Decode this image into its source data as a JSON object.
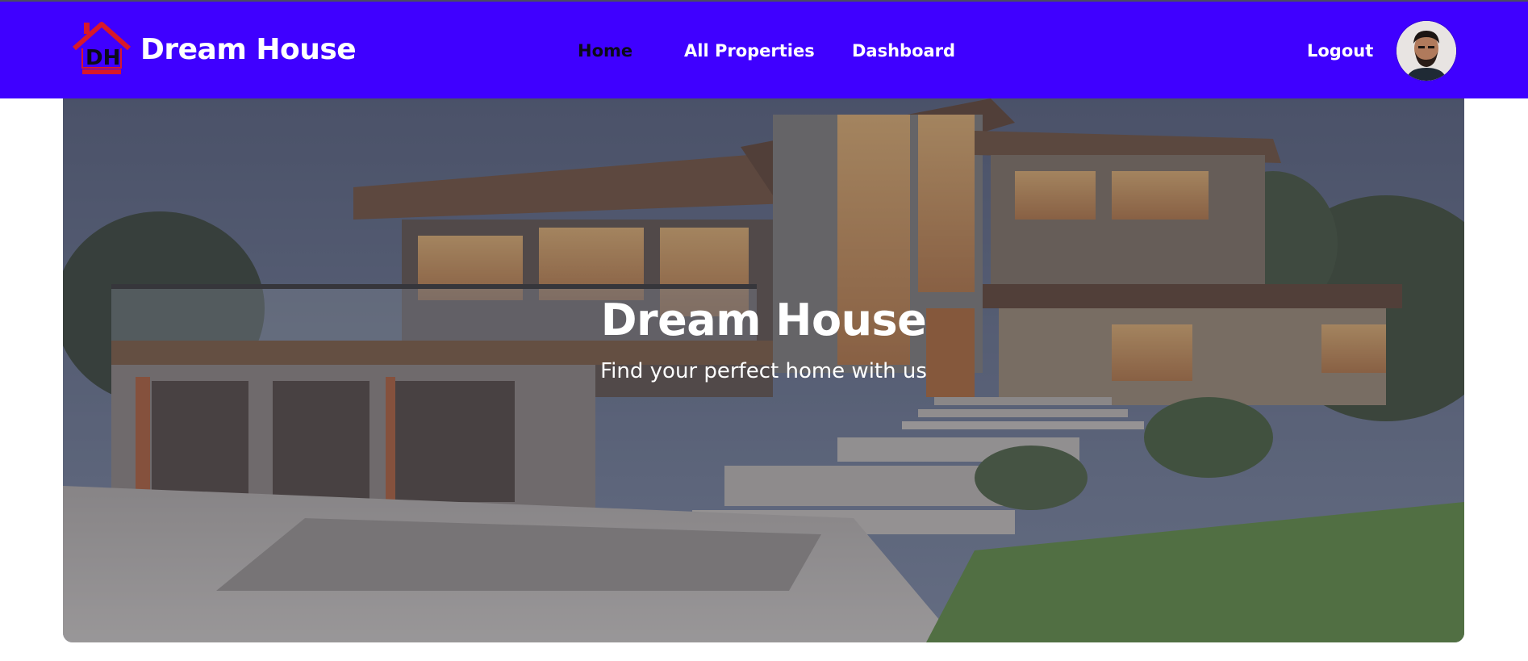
{
  "navbar": {
    "brand": "Dream House",
    "logo_icon": "house-logo-icon",
    "logo_text": "DH",
    "links": [
      {
        "label": "Home",
        "active": true
      },
      {
        "label": "All Properties",
        "active": false
      },
      {
        "label": "Dashboard",
        "active": false
      }
    ],
    "logout_label": "Logout",
    "avatar_icon": "user-avatar",
    "background_color": "#3f00ff",
    "active_link_color": "#0b0b1a"
  },
  "hero": {
    "title": "Dream House",
    "subtitle": "Find your perfect home with us",
    "image": "modern-house-photo"
  }
}
